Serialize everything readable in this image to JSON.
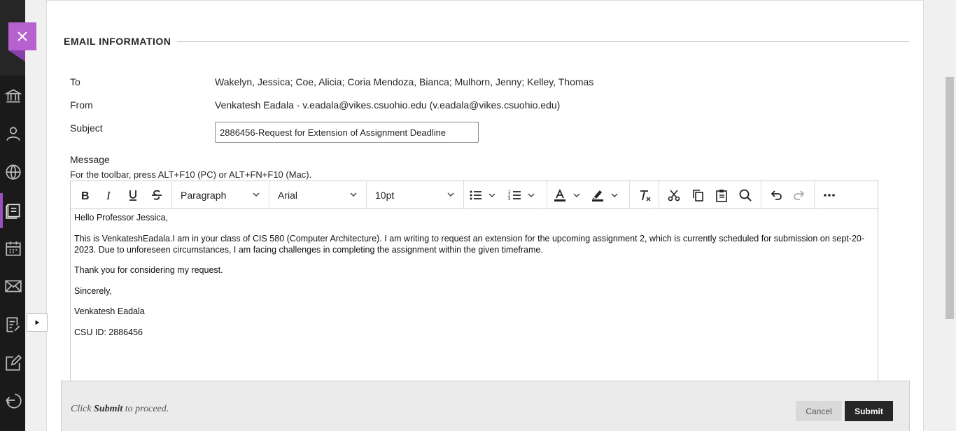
{
  "section": {
    "heading": "EMAIL INFORMATION"
  },
  "fields": {
    "to_label": "To",
    "to_value": "Wakelyn, Jessica; Coe, Alicia; Coria Mendoza, Bianca; Mulhorn, Jenny; Kelley, Thomas",
    "from_label": "From",
    "from_value": "Venkatesh Eadala - v.eadala@vikes.csuohio.edu (v.eadala@vikes.csuohio.edu)",
    "subject_label": "Subject",
    "subject_value": "2886456-Request for Extension of Assignment Deadline",
    "message_label": "Message",
    "toolbar_hint": "For the toolbar, press ALT+F10 (PC) or ALT+FN+F10 (Mac)."
  },
  "toolbar": {
    "block_format": "Paragraph",
    "font_family": "Arial",
    "font_size": "10pt",
    "icons": [
      "bold-icon",
      "italic-icon",
      "underline-icon",
      "strikethrough-icon",
      "bullet-list-icon",
      "numbered-list-icon",
      "text-color-icon",
      "highlight-icon",
      "clear-formatting-icon",
      "cut-icon",
      "copy-icon",
      "paste-icon",
      "search-icon",
      "undo-icon",
      "redo-icon",
      "more-icon"
    ]
  },
  "message": {
    "p1": "Hello Professor Jessica,",
    "p2": "This is VenkateshEadala.I am in your class of CIS 580 (Computer Architecture). I am writing to request an extension for the upcoming assignment 2, which is currently scheduled for submission on sept-20-2023. Due to unforeseen circumstances, I am facing challenges in completing the assignment within the given timeframe.",
    "p3": "Thank you for considering my request.",
    "p4": "Sincerely,",
    "p5": "Venkatesh Eadala",
    "p6": "CSU ID: 2886456"
  },
  "footer": {
    "hint_prefix": "Click",
    "hint_bold": "Submit",
    "hint_suffix": "to proceed.",
    "cancel_label": "Cancel",
    "submit_label": "Submit"
  },
  "nav": {
    "icons": [
      "close-icon",
      "institution-icon",
      "profile-icon",
      "globe-icon",
      "courses-icon",
      "calendar-icon",
      "messages-icon",
      "grades-icon",
      "edit-icon",
      "sign-out-icon"
    ]
  },
  "colors": {
    "accent": "#b661cf",
    "rail": "#1a1a1a",
    "primary_button": "#262626"
  }
}
